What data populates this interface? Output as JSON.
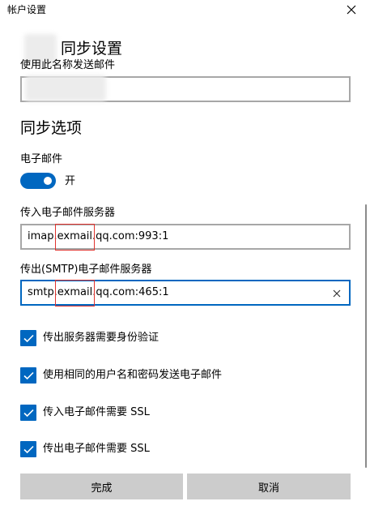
{
  "window": {
    "title": "帐户设置",
    "close_icon": "close-icon"
  },
  "sync_settings": {
    "header": "同步设置",
    "send_name_label": "使用此名称发送邮件"
  },
  "sync_options": {
    "header": "同步选项",
    "email_label": "电子邮件",
    "email_toggle_state": "开",
    "email_toggle_on": true
  },
  "incoming": {
    "label": "传入电子邮件服务器",
    "value_prefix": "imap.",
    "value_highlight": "exmail",
    "value_suffix": ".qq.com:993:1"
  },
  "outgoing": {
    "label": "传出(SMTP)电子邮件服务器",
    "value_prefix": "smtp.",
    "value_highlight": "exmail",
    "value_suffix": ".qq.com:465:1",
    "clear_icon": "clear-icon"
  },
  "checkboxes": [
    {
      "label": "传出服务器需要身份验证",
      "checked": true
    },
    {
      "label": "使用相同的用户名和密码发送电子邮件",
      "checked": true
    },
    {
      "label": "传入电子邮件需要 SSL",
      "checked": true
    },
    {
      "label": "传出电子邮件需要 SSL",
      "checked": true
    }
  ],
  "buttons": {
    "done": "完成",
    "cancel": "取消"
  },
  "colors": {
    "accent": "#0067c0",
    "highlight_border": "#e0342f",
    "button_bg": "#cccccc"
  }
}
